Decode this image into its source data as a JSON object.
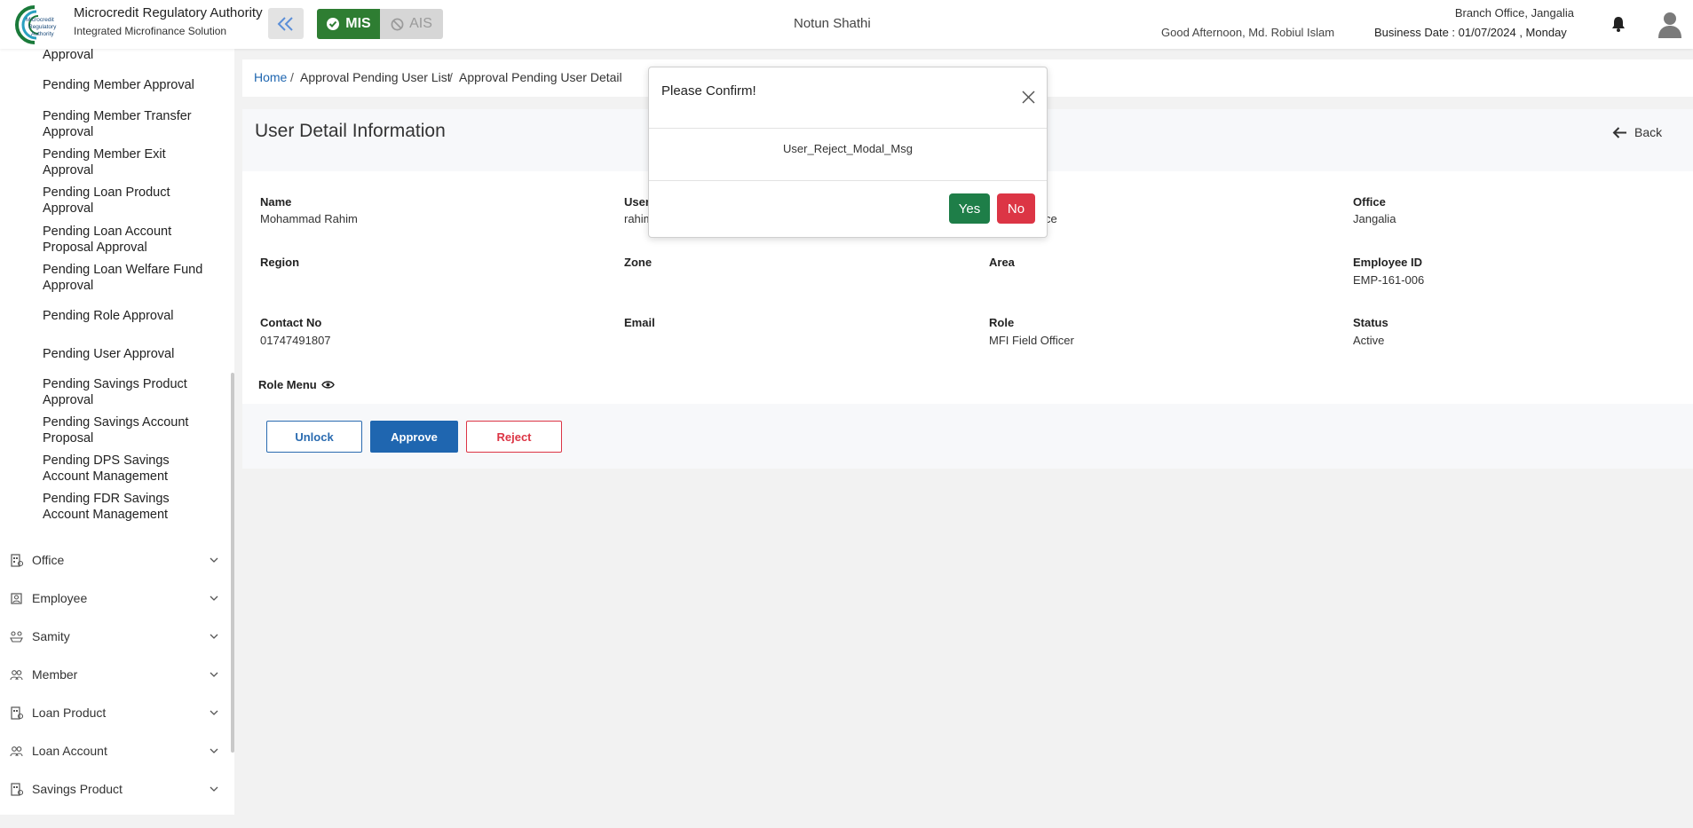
{
  "header": {
    "logo_text": "Microcredit Regulatory Authority",
    "org_name": "Microcredit Regulatory Authority",
    "org_subtitle": "Integrated Microfinance Solution",
    "mis_label": "MIS",
    "ais_label": "AIS",
    "samity_name": "Notun Shathi",
    "branch": "Branch Office, Jangalia",
    "greeting": "Good Afternoon, Md. Robiul Islam",
    "business_date": "Business Date : 01/07/2024 , Monday"
  },
  "sidebar": {
    "sub_items": [
      "Approval",
      "Pending Member Approval",
      "Pending Member Transfer Approval",
      "Pending Member Exit Approval",
      "Pending Loan Product Approval",
      "Pending Loan Account Proposal Approval",
      "Pending Loan Welfare Fund Approval",
      "Pending Role Approval",
      "Pending User Approval",
      "Pending Savings Product Approval",
      "Pending Savings Account Proposal",
      "Pending DPS Savings Account Management",
      "Pending FDR Savings Account Management"
    ],
    "menu": [
      {
        "label": "Office",
        "icon": "building-icon"
      },
      {
        "label": "Employee",
        "icon": "employee-icon"
      },
      {
        "label": "Samity",
        "icon": "samity-icon"
      },
      {
        "label": "Member",
        "icon": "member-icon"
      },
      {
        "label": "Loan Product",
        "icon": "loan-product-icon"
      },
      {
        "label": "Loan Account",
        "icon": "loan-account-icon"
      },
      {
        "label": "Savings Product",
        "icon": "savings-product-icon"
      }
    ]
  },
  "breadcrumb": {
    "home": "Home",
    "sep": "/",
    "list": "Approval Pending User List",
    "detail": "Approval Pending User Detail"
  },
  "page": {
    "title": "User Detail Information",
    "back_label": "Back"
  },
  "details": {
    "name_label": "Name",
    "name_value": "Mohammad Rahim",
    "user_label": "User",
    "user_value": "rahim",
    "third_value": "ce",
    "office_label": "Office",
    "office_value": "Jangalia",
    "region_label": "Region",
    "zone_label": "Zone",
    "area_label": "Area",
    "empid_label": "Employee ID",
    "empid_value": "EMP-161-006",
    "contact_label": "Contact No",
    "contact_value": "01747491807",
    "email_label": "Email",
    "role_label": "Role",
    "role_value": "MFI Field Officer",
    "status_label": "Status",
    "status_value": "Active",
    "role_menu_label": "Role Menu"
  },
  "actions": {
    "unlock": "Unlock",
    "approve": "Approve",
    "reject": "Reject"
  },
  "modal": {
    "title": "Please Confirm!",
    "message": "User_Reject_Modal_Msg",
    "yes": "Yes",
    "no": "No"
  },
  "colors": {
    "mis_green": "#2e7d32",
    "primary_blue": "#1f66b0",
    "danger_red": "#dc3545",
    "yes_green": "#1e7e48"
  }
}
